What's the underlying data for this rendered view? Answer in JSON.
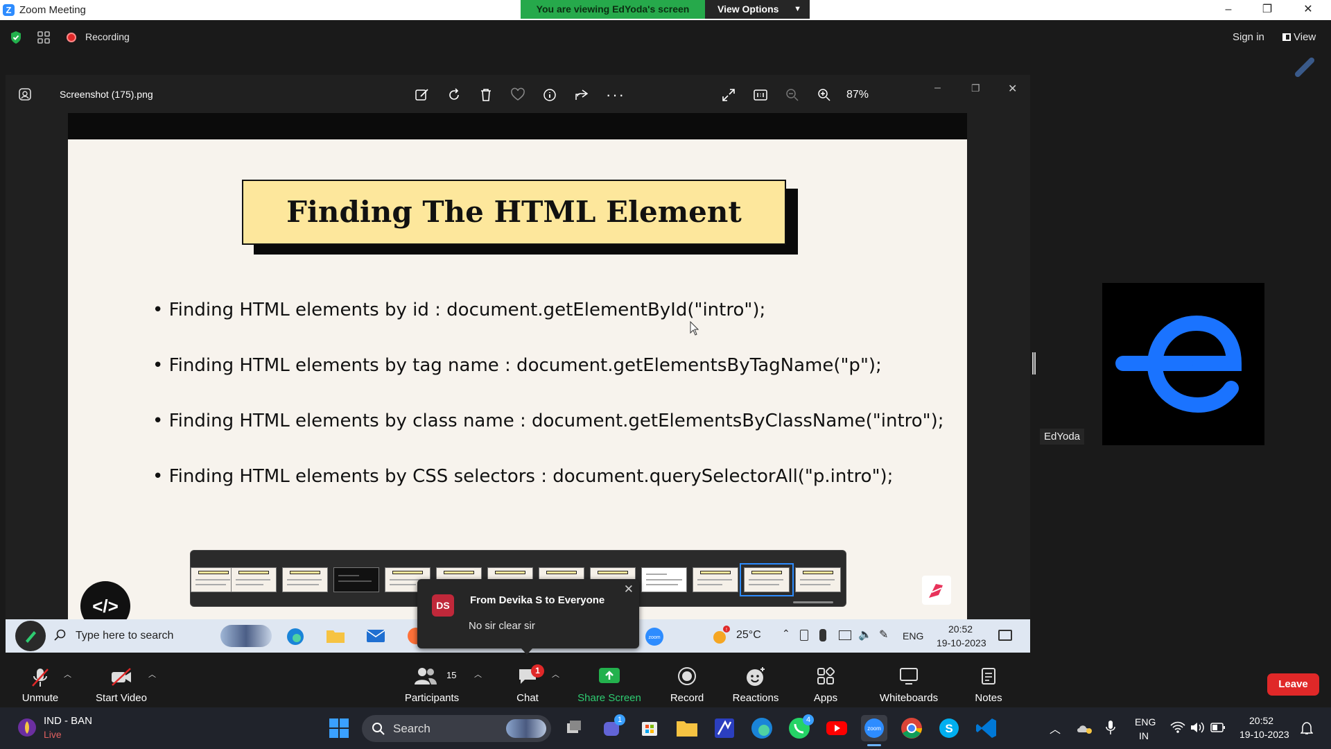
{
  "window": {
    "app_title": "Zoom Meeting",
    "banner": "You are viewing EdYoda's screen",
    "view_options": "View Options",
    "minimize": "–",
    "restore": "❐",
    "close": "✕"
  },
  "zoom_top": {
    "recording": "Recording",
    "sign_in": "Sign in",
    "view": "View"
  },
  "viewer": {
    "filename": "Screenshot (175).png",
    "zoom_level": "87%"
  },
  "slide": {
    "title": "Finding The HTML Element",
    "bullets": [
      "Finding HTML elements by id : document.getElementById(\"intro\");",
      "Finding HTML elements by tag name : document.getElementsByTagName(\"p\");",
      "Finding HTML elements by class name : document.getElementsByClassName(\"intro\");",
      "Finding HTML elements by CSS selectors : document.querySelectorAll(\"p.intro\");"
    ],
    "logo_glyph": "</>"
  },
  "remote_taskbar": {
    "search_placeholder": "Type here to search",
    "temperature": "25°C",
    "language": "ENG",
    "time": "20:52",
    "date": "19-10-2023"
  },
  "chat_popup": {
    "avatar_initials": "DS",
    "from": "From Devika S to Everyone",
    "message": "No sir clear sir"
  },
  "speaker": {
    "name": "EdYoda",
    "accent": "#1a73ff"
  },
  "toolbar": {
    "unmute": "Unmute",
    "start_video": "Start Video",
    "participants": "Participants",
    "participants_count": "15",
    "chat": "Chat",
    "chat_badge": "1",
    "share_screen": "Share Screen",
    "record": "Record",
    "reactions": "Reactions",
    "apps": "Apps",
    "whiteboards": "Whiteboards",
    "notes": "Notes",
    "leave": "Leave"
  },
  "win_taskbar": {
    "weather_line1": "IND - BAN",
    "weather_line2": "Live",
    "search": "Search",
    "lang_line1": "ENG",
    "lang_line2": "IN",
    "time": "20:52",
    "date": "19-10-2023",
    "teams_badge": "1",
    "whatsapp_badge": "4"
  },
  "colors": {
    "zoom_blue": "#2d8cff",
    "banner_green": "#26a94b",
    "leave_red": "#e02828",
    "slide_title_bg": "#fde79c"
  }
}
